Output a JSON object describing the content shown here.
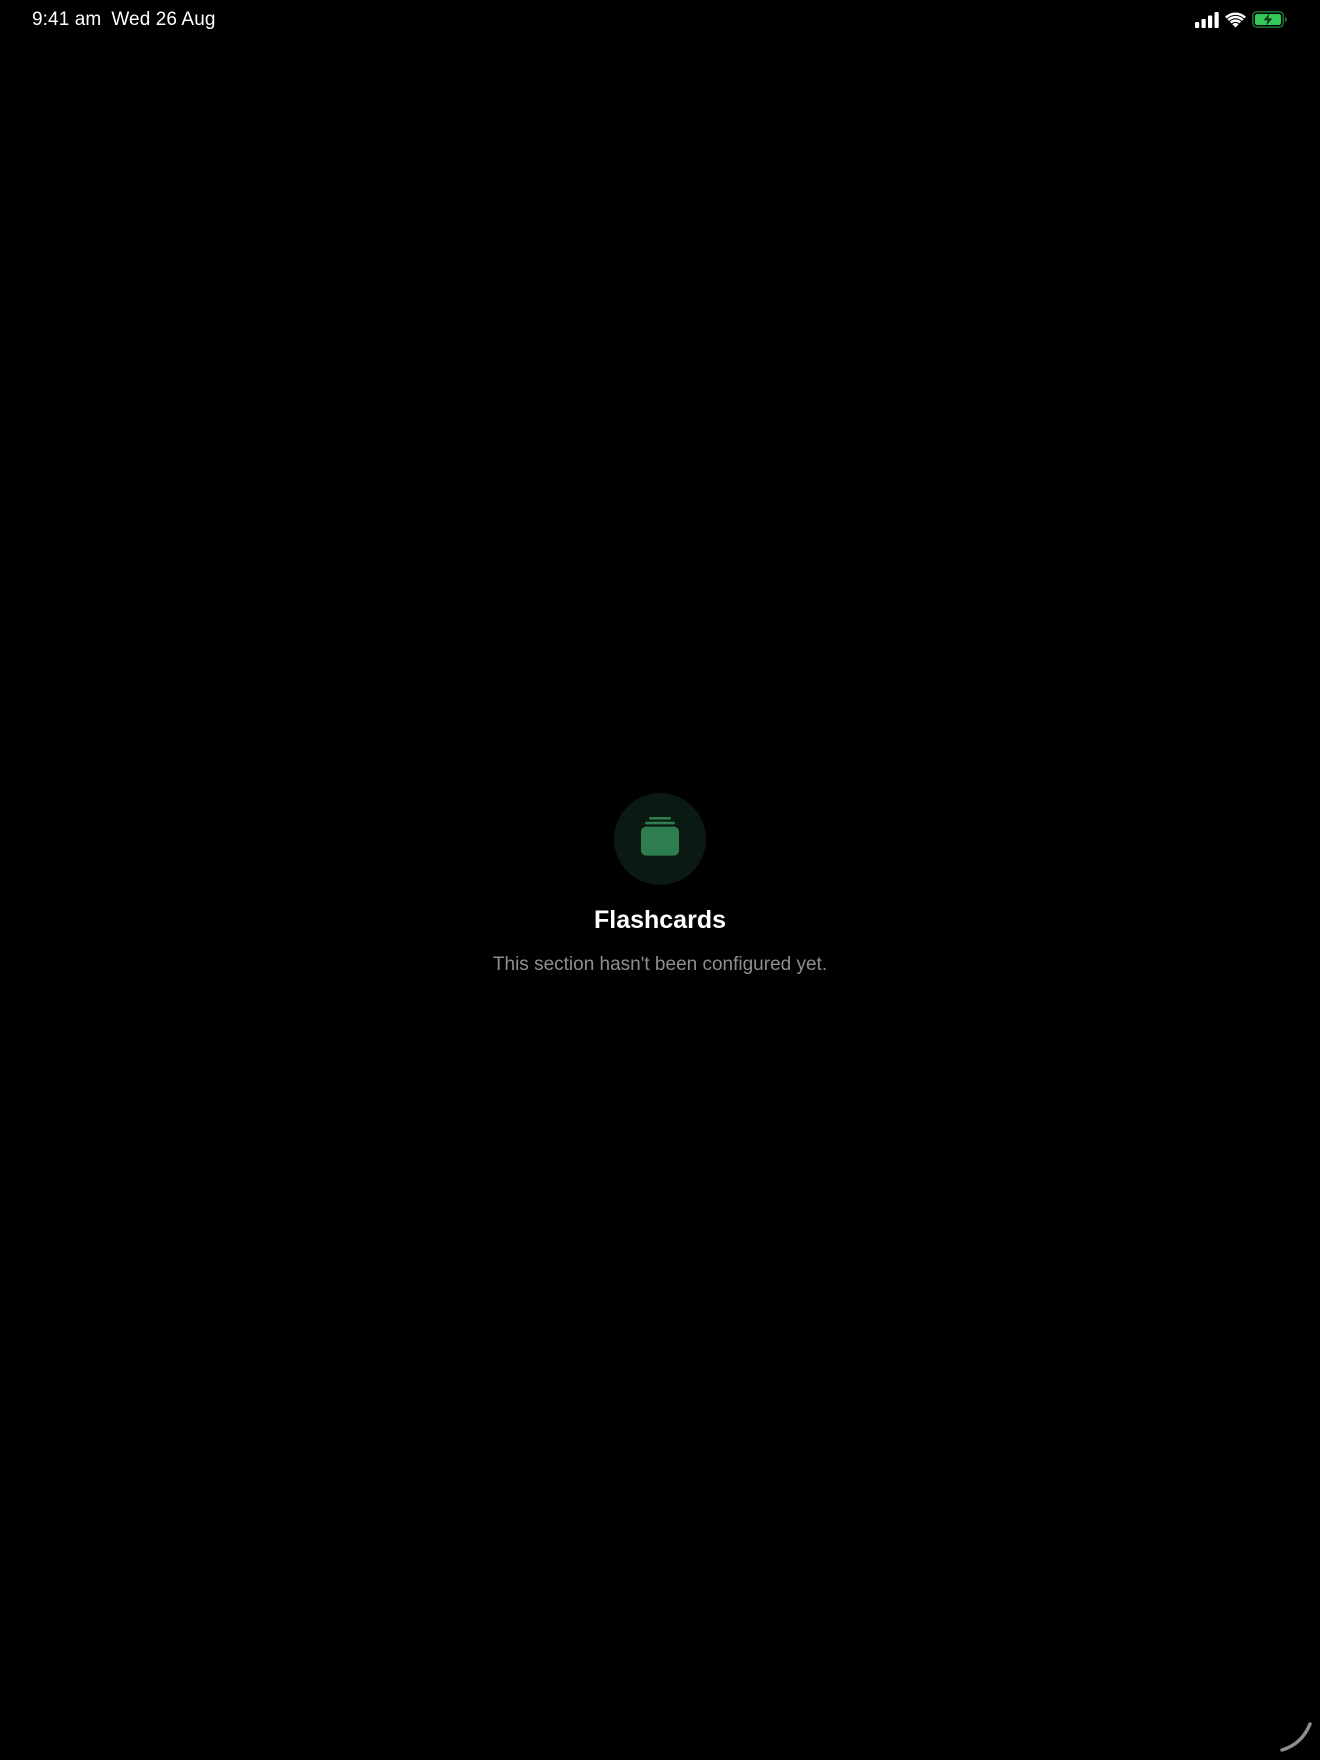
{
  "status_bar": {
    "time": "9:41 am",
    "date": "Wed 26 Aug",
    "icons": [
      "cellular-signal-icon",
      "wifi-icon",
      "battery-charging-icon"
    ],
    "battery_color": "#34c759"
  },
  "empty_state": {
    "icon": "flashcards-stack-icon",
    "icon_color": "#2e7d4f",
    "title": "Flashcards",
    "message": "This section hasn't been configured yet."
  },
  "corner_indicator": {
    "icon": "loading-arc-icon"
  }
}
